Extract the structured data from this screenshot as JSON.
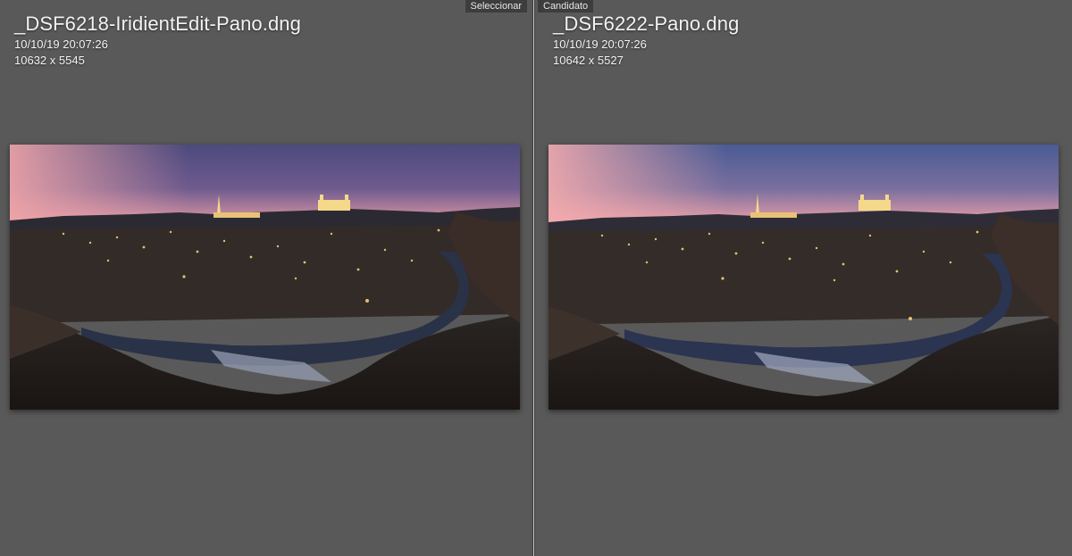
{
  "left": {
    "tag": "Seleccionar",
    "filename": "_DSF6218-IridientEdit-Pano.dng",
    "datetime": "10/10/19 20:07:26",
    "dimensions": "10632 x 5545",
    "sky_top": "#4c4a7d",
    "sky_horizon": "#e39aa6"
  },
  "right": {
    "tag": "Candidato",
    "filename": "_DSF6222-Pano.dng",
    "datetime": "10/10/19 20:07:26",
    "dimensions": "10642 x 5527",
    "sky_top": "#4a5b94",
    "sky_horizon": "#efa1a8"
  },
  "colors": {
    "background": "#595959",
    "tag_bg": "#3d3d3d",
    "text": "#f2f2f2"
  }
}
